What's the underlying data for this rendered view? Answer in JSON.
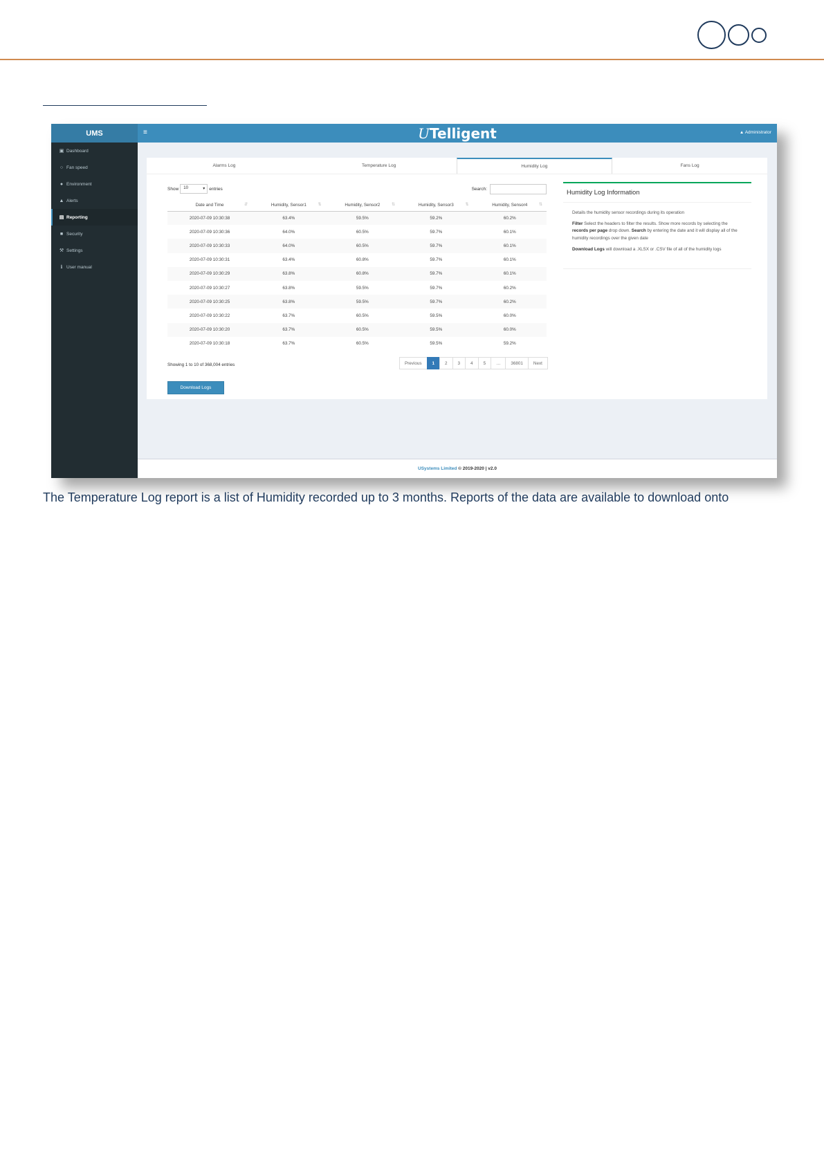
{
  "app": {
    "brand": "UMS",
    "title_prefix": "U",
    "title_rest": "Telligent",
    "menu_glyph": "≡",
    "user_label": "Administrator"
  },
  "sidebar": {
    "items": [
      {
        "label": "Dashboard",
        "icon": "dashboard-icon",
        "glyph": "▣"
      },
      {
        "label": "Fan speed",
        "icon": "fan-icon",
        "glyph": "○"
      },
      {
        "label": "Environment",
        "icon": "globe-icon",
        "glyph": "●"
      },
      {
        "label": "Alerts",
        "icon": "bell-icon",
        "glyph": "▲"
      },
      {
        "label": "Reporting",
        "icon": "copy-icon",
        "glyph": "▤",
        "active": true
      },
      {
        "label": "Security",
        "icon": "camera-icon",
        "glyph": "■"
      },
      {
        "label": "Settings",
        "icon": "wrench-icon",
        "glyph": "⚒"
      },
      {
        "label": "User manual",
        "icon": "info-icon",
        "glyph": "ℹ"
      }
    ]
  },
  "tabs": [
    {
      "label": "Alarms Log"
    },
    {
      "label": "Temperature Log"
    },
    {
      "label": "Humidity Log",
      "active": true
    },
    {
      "label": "Fans Log"
    }
  ],
  "table_controls": {
    "show_label": "Show",
    "entries_value": "10",
    "entries_label": "entries",
    "search_label": "Search:"
  },
  "table": {
    "columns": [
      "Date and Time",
      "Humidity, Sensor1",
      "Humidity, Sensor2",
      "Humidity, Sensor3",
      "Humidity, Sensor4"
    ],
    "rows": [
      [
        "2020-07-09 10:30:38",
        "63.4%",
        "59.5%",
        "59.2%",
        "60.2%"
      ],
      [
        "2020-07-09 10:30:36",
        "64.0%",
        "60.5%",
        "59.7%",
        "60.1%"
      ],
      [
        "2020-07-09 10:30:33",
        "64.0%",
        "60.5%",
        "59.7%",
        "60.1%"
      ],
      [
        "2020-07-09 10:30:31",
        "63.4%",
        "60.8%",
        "59.7%",
        "60.1%"
      ],
      [
        "2020-07-09 10:30:29",
        "63.8%",
        "60.8%",
        "59.7%",
        "60.1%"
      ],
      [
        "2020-07-09 10:30:27",
        "63.8%",
        "59.5%",
        "59.7%",
        "60.2%"
      ],
      [
        "2020-07-09 10:30:25",
        "63.8%",
        "59.5%",
        "59.7%",
        "60.2%"
      ],
      [
        "2020-07-09 10:30:22",
        "63.7%",
        "60.5%",
        "59.5%",
        "60.0%"
      ],
      [
        "2020-07-09 10:30:20",
        "63.7%",
        "60.5%",
        "59.5%",
        "60.0%"
      ],
      [
        "2020-07-09 10:30:18",
        "63.7%",
        "60.5%",
        "59.5%",
        "59.2%"
      ]
    ],
    "info": "Showing 1 to 10 of 368,004 entries"
  },
  "pagination": {
    "previous": "Previous",
    "pages": [
      "1",
      "2",
      "3",
      "4",
      "5",
      "…",
      "36801"
    ],
    "active": "1",
    "next": "Next"
  },
  "download_button": "Download Logs",
  "info_box": {
    "title": "Humidity Log Information",
    "p1": "Details the humidity sensor recordings during its operation",
    "filter_bold": "Filter",
    "filter_text1": " Select the headers to filter the results. Show more records by selecting the ",
    "rpp_bold": "records per page",
    "filter_text2": " drop down. ",
    "search_bold": "Search",
    "filter_text3": " by entering the date and it will display all of the humidity recordings over the given date",
    "dl_bold": "Download Logs",
    "dl_text": " will download a .XLSX or .CSV file of all of the humidity logs"
  },
  "footer": {
    "company": "USystems Limited",
    "rest": " © 2019-2020 | v2.0"
  },
  "caption": "The Temperature Log report is a list of Humidity recorded up to 3 months. Reports of the data are available to download onto",
  "colors": {
    "accent": "#3c8dbc",
    "sidebar": "#222d32",
    "info_border": "#00a65a",
    "header_rule": "#d08a4f",
    "text_navy": "#1f3a5c"
  }
}
